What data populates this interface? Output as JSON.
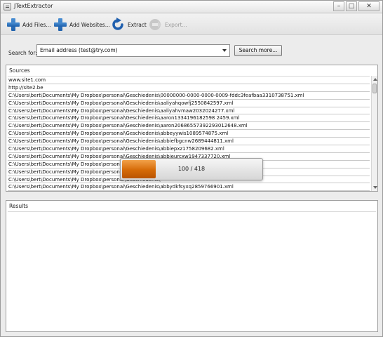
{
  "window": {
    "title": "JTextExtractor",
    "minimize": "–",
    "maximize": "□",
    "close": "✕"
  },
  "toolbar": {
    "add_files": "Add Files...",
    "add_websites": "Add Websites...",
    "extract": "Extract",
    "export": "Export...",
    "icons": [
      "plus-icon",
      "plus-icon",
      "refresh-arrow-icon",
      "export-icon"
    ],
    "icon_color": "#2a6fc0",
    "disabled_color": "#9c9c9c"
  },
  "search": {
    "label": "Search for:",
    "selected": "Email address (test@try.com)",
    "more_button": "Search more..."
  },
  "sources": {
    "title": "Sources",
    "items": [
      "www.site1.com",
      "http://site2.be",
      "C:\\Users\\bert\\Documents\\My Dropbox\\personal\\Geschiedenis\\00000000-0000-0000-0009-fddc3feafbaa3310738751.xml",
      "C:\\Users\\bert\\Documents\\My Dropbox\\personal\\Geschiedenis\\aaliyahqowfj2550842597.xml",
      "C:\\Users\\bert\\Documents\\My Dropbox\\personal\\Geschiedenis\\aaliyahvmaw2032024277.xml",
      "C:\\Users\\bert\\Documents\\My Dropbox\\personal\\Geschiedenis\\aaron1334196182598 2459.xml",
      "C:\\Users\\bert\\Documents\\My Dropbox\\personal\\Geschiedenis\\aaron20686557392293012648.xml",
      "C:\\Users\\bert\\Documents\\My Dropbox\\personal\\Geschiedenis\\abbeyywis1089574875.xml",
      "C:\\Users\\bert\\Documents\\My Dropbox\\personal\\Geschiedenis\\abbiefbgcnw2689444811.xml",
      "C:\\Users\\bert\\Documents\\My Dropbox\\personal\\Geschiedenis\\abbiepxz1758209682.xml",
      "C:\\Users\\bert\\Documents\\My Dropbox\\personal\\Geschiedenis\\abbieurcxw1947337720.xml",
      "C:\\Users\\bert\\Documents\\My Dropbox\\personal\\Geschiedenis\\",
      "C:\\Users\\bert\\Documents\\My Dropbox\\personal\\Geschiedenis\\",
      "C:\\Users\\bert\\Documents\\My Dropbox\\personal\\Geschiedenis\\",
      "C:\\Users\\bert\\Documents\\My Dropbox\\personal\\Geschiedenis\\abbydkfsyxq2859766901.xml",
      "C:\\Users\\bert\\Documents\\My Dropbox\\personal\\Geschiedenis\\"
    ]
  },
  "progress": {
    "text": "100 / 418",
    "current": 100,
    "total": 418,
    "color": "#d56a07"
  },
  "results": {
    "title": "Results"
  }
}
